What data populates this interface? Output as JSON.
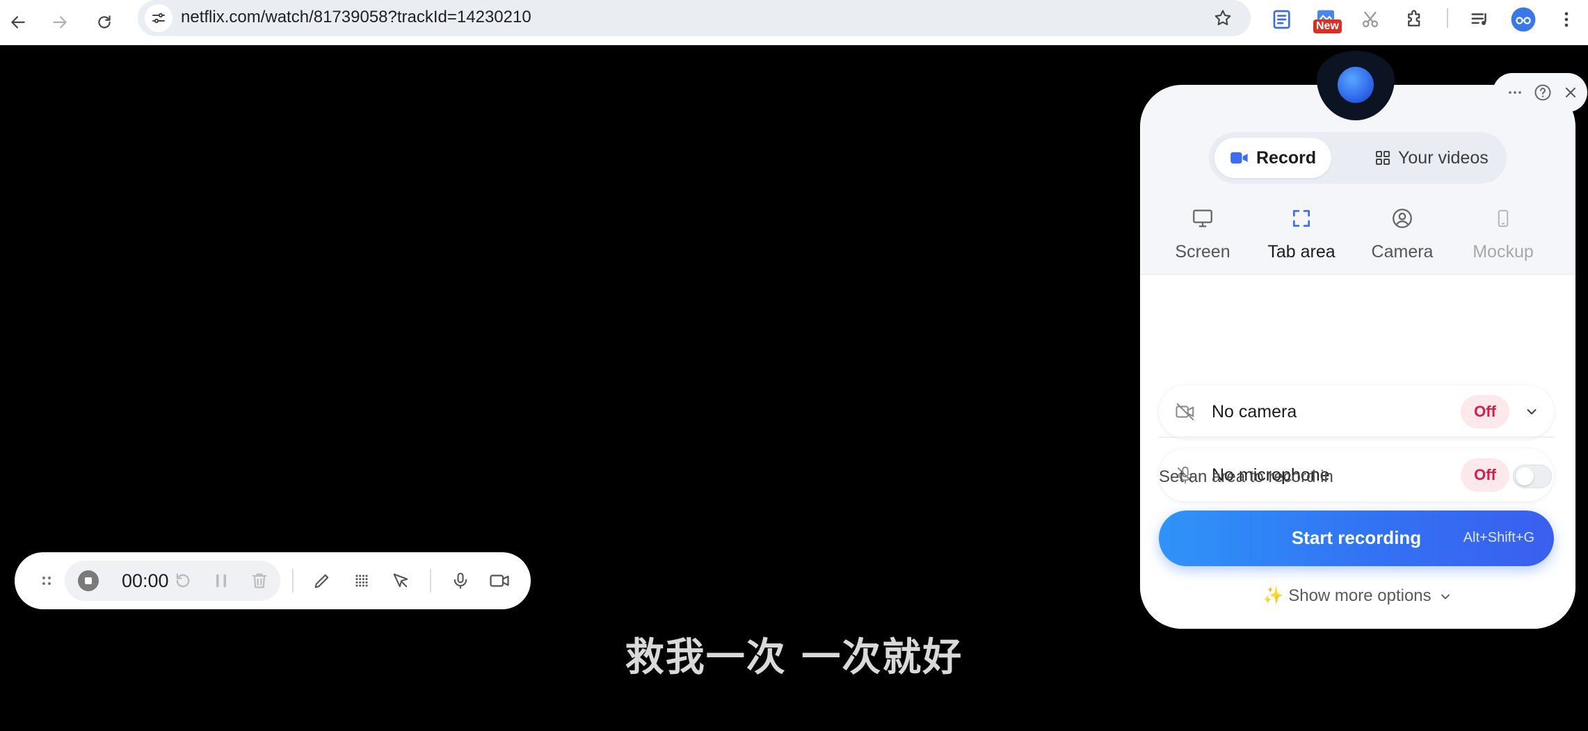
{
  "browser": {
    "url": "netflix.com/watch/81739058?trackId=14230210",
    "new_badge": "New"
  },
  "subtitle": "救我一次 一次就好",
  "toolbar": {
    "timer": "00:00"
  },
  "panel": {
    "mode_tabs": [
      {
        "label": "Record"
      },
      {
        "label": "Your videos"
      }
    ],
    "source_tabs": [
      {
        "label": "Screen"
      },
      {
        "label": "Tab area"
      },
      {
        "label": "Camera"
      },
      {
        "label": "Mockup"
      }
    ],
    "camera": {
      "label": "No camera",
      "status": "Off"
    },
    "microphone": {
      "label": "No microphone",
      "status": "Off"
    },
    "area_label": "Set an area to record in",
    "start_label": "Start recording",
    "start_shortcut": "Alt+Shift+G",
    "more_options": "✨ Show more options",
    "colors": {
      "accent": "#3a6df0",
      "off_badge_text": "#d31f4a",
      "off_badge_bg": "#fde8ec"
    }
  }
}
